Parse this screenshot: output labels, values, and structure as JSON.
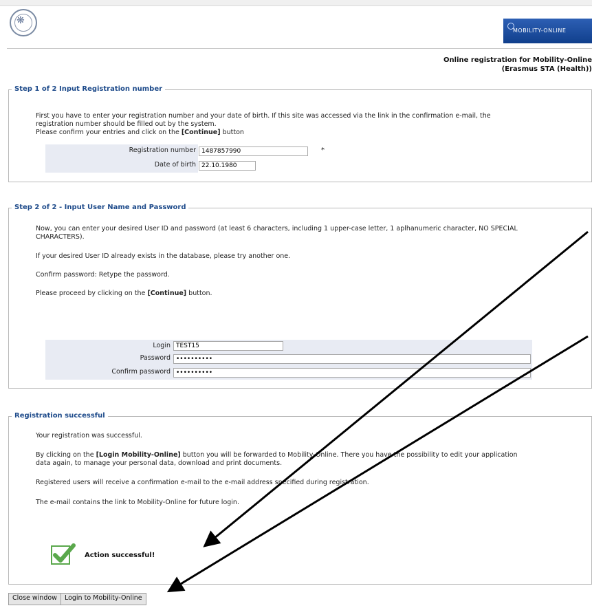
{
  "header": {
    "brand": "MOBILITY-ONLINE",
    "title_line1": "Online registration for Mobility-Online",
    "title_line2": "(Erasmus STA (Health))"
  },
  "step1": {
    "legend": "Step 1 of 2 Input Registration number",
    "text1": "First you have to enter your registration number and your date of birth. If this site was accessed via the link in the confirmation e-mail, the",
    "text2": "registration number should be filled out by the system.",
    "text3_pre": "Please confirm your entries and click on the ",
    "text3_bold": "[Continue]",
    "text3_post": " button",
    "reg_label": "Registration number",
    "reg_value": "1487857990",
    "required_mark": "*",
    "dob_label": "Date of birth",
    "dob_value": "22.10.1980"
  },
  "step2": {
    "legend": "Step 2 of 2 - Input User Name and Password",
    "text1": "Now, you can enter your desired User ID and password (at least 6 characters, including 1 upper-case letter, 1 aplhanumeric character, NO SPECIAL",
    "text2": "CHARACTERS).",
    "text3": "If your desired User ID already exists in the database, please try another one.",
    "text4": "Confirm password: Retype the password.",
    "text5_pre": "Please proceed by clicking on the ",
    "text5_bold": "[Continue]",
    "text5_post": " button.",
    "login_label": "Login",
    "login_value": "TEST15",
    "password_label": "Password",
    "password_value": "••••••••••",
    "confirm_label": "Confirm password",
    "confirm_value": "••••••••••"
  },
  "success": {
    "legend": "Registration successful",
    "text1": "Your registration was successful.",
    "text2_pre": "By clicking on the ",
    "text2_bold": "[Login Mobility-Online]",
    "text2_post": " button you will be forwarded to Mobility-Online. There you have the possibility to edit your application",
    "text3": "data again, to manage your personal data, download and print documents.",
    "text4": "Registered users will receive a confirmation e-mail to the e-mail address specified during registration.",
    "text5": "The e-mail contains the link to Mobility-Online for future login.",
    "message": "Action successful!"
  },
  "buttons": {
    "close": "Close window",
    "login": "Login to Mobility-Online"
  },
  "colors": {
    "legend": "#1d4a8a",
    "form_bg": "#e8ebf3",
    "check": "#5aa84c"
  }
}
